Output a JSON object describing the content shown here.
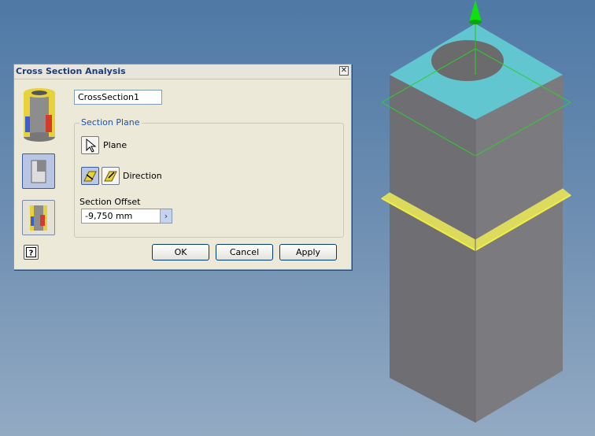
{
  "dialog": {
    "title": "Cross Section Analysis",
    "close_icon": "close-icon",
    "name_value": "CrossSection1",
    "section_plane": {
      "group_label": "Section Plane",
      "plane_label": "Plane",
      "direction_label": "Direction",
      "offset_label": "Section Offset",
      "offset_value": "-9,750 mm"
    },
    "buttons": {
      "ok": "OK",
      "cancel": "Cancel",
      "apply": "Apply"
    }
  },
  "colors": {
    "top_face": "#5fc8d2",
    "body": "#7a7a7e",
    "section_plane": "#e2e64a",
    "work_plane": "#2ccf2c"
  }
}
